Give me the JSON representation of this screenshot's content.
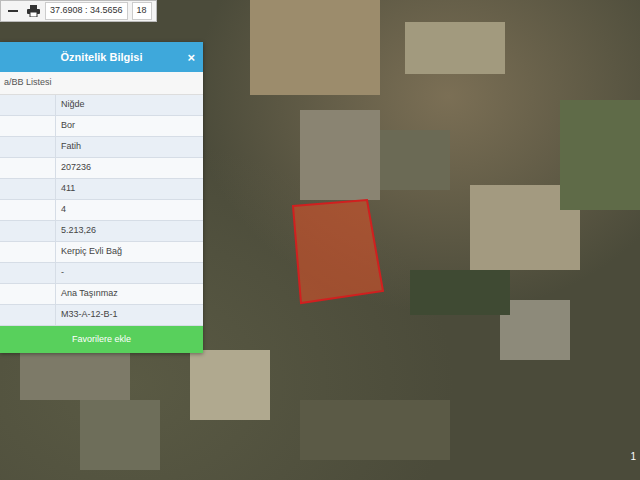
{
  "toolbar": {
    "coordinates": "37.6908 : 34.5656",
    "zoom": "18"
  },
  "panel": {
    "title": "Öznitelik Bilgisi",
    "close": "×",
    "list_label": "a/BB Listesi",
    "values": [
      "Niğde",
      "Bor",
      "Fatih",
      "207236",
      "411",
      "4",
      "5.213,26",
      "Kerpiç Evli Bağ",
      "-",
      "Ana Taşınmaz",
      "M33-A-12-B-1"
    ],
    "button": "Favorilere ekle"
  },
  "scale_label": "1"
}
